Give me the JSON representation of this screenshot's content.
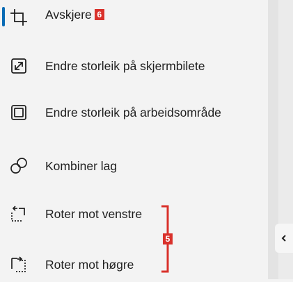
{
  "menu": {
    "items": [
      {
        "label": "Avskjere",
        "badge": "6",
        "icon": "crop-icon",
        "active": true
      },
      {
        "label": "Endre storleik på skjermbilete",
        "icon": "resize-image-icon"
      },
      {
        "label": "Endre storleik på arbeidsområde",
        "icon": "resize-canvas-icon"
      },
      {
        "label": "Kombiner lag",
        "icon": "combine-layers-icon"
      },
      {
        "label": "Roter mot venstre",
        "icon": "rotate-left-icon"
      },
      {
        "label": "Roter mot høgre",
        "icon": "rotate-right-icon"
      }
    ]
  },
  "annotations": {
    "group_badge": "5"
  },
  "colors": {
    "accent": "#0a6bb5",
    "badge": "#d9312b",
    "background": "#f3f3f3"
  },
  "panel": {
    "collapse_icon": "chevron-left-icon"
  }
}
